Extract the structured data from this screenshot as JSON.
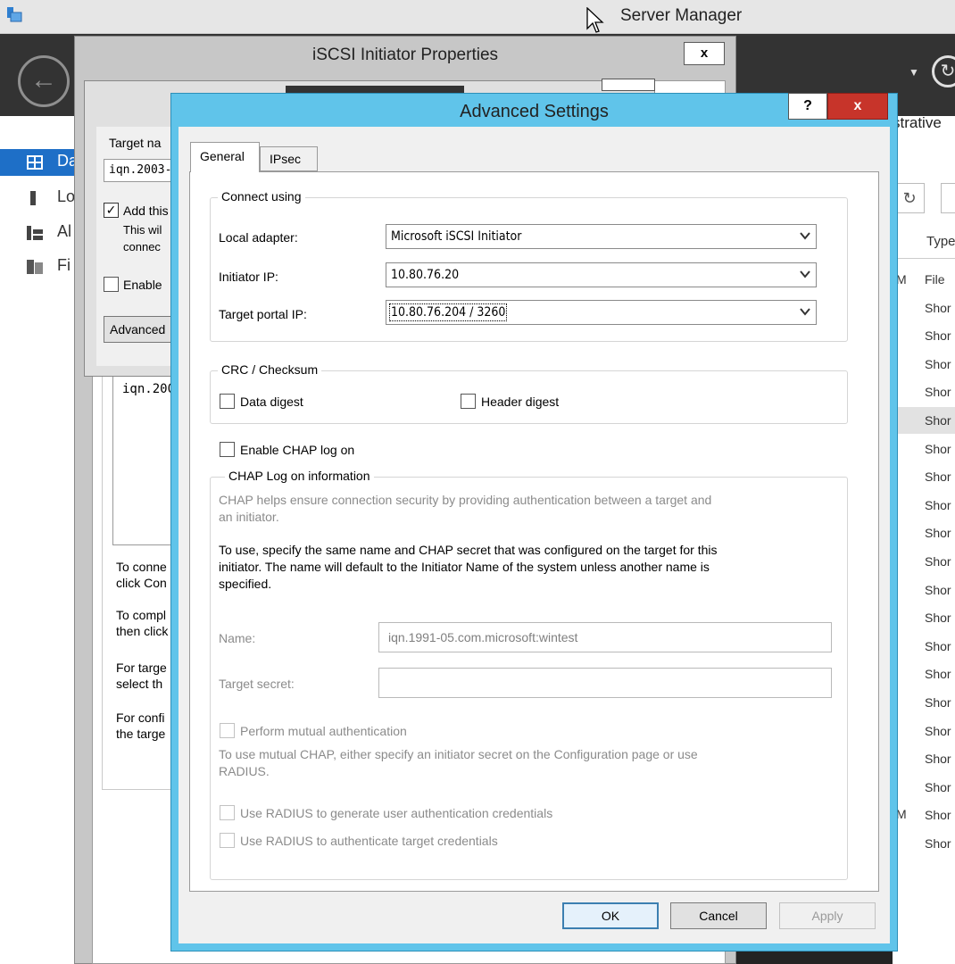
{
  "server_manager": {
    "title": "Server Manager",
    "nav": [
      {
        "label": "Da",
        "icon": "dashboard-icon"
      },
      {
        "label": "Lo",
        "icon": "local-server-icon"
      },
      {
        "label": "Al",
        "icon": "all-servers-icon"
      },
      {
        "label": "Fi",
        "icon": "file-services-icon"
      }
    ],
    "admin_label": "strative",
    "column_type": "Type",
    "rows": [
      "File",
      "Shor",
      "Shor",
      "Shor",
      "Shor",
      "Shor",
      "Shor",
      "Shor",
      "Shor",
      "Shor",
      "Shor",
      "Shor",
      "Shor",
      "Shor",
      "Shor",
      "Shor",
      "Shor",
      "Shor",
      "Shor",
      "Shor",
      "Shor"
    ],
    "row_left_marks": [
      "M",
      "M"
    ]
  },
  "iscsi_window": {
    "title": "iSCSI Initiator Properties",
    "close_label": "x",
    "list_item": "iqn.200",
    "texts": [
      [
        "To conne",
        "click Con"
      ],
      [
        "To compl",
        "then click"
      ],
      [
        "For targe",
        "select th"
      ],
      [
        "For confi",
        "the targe"
      ]
    ]
  },
  "connect_window": {
    "target_label": "Target na",
    "target_value": "iqn.2003-",
    "add_checked_mark": "✓",
    "add_label": "Add this",
    "desc1": "This wil",
    "desc2": "connec",
    "enable_label": "Enable",
    "advanced_label": "Advanced"
  },
  "advanced": {
    "title": "Advanced Settings",
    "help_label": "?",
    "close_label": "x",
    "tabs": [
      {
        "label": "General",
        "active": true
      },
      {
        "label": "IPsec",
        "active": false
      }
    ],
    "connect_using": {
      "title": "Connect using",
      "local_adapter_label": "Local adapter:",
      "local_adapter_value": "Microsoft iSCSI Initiator",
      "initiator_ip_label": "Initiator IP:",
      "initiator_ip_value": "10.80.76.20",
      "target_portal_label": "Target portal IP:",
      "target_portal_value": "10.80.76.204 / 3260"
    },
    "crc": {
      "title": "CRC / Checksum",
      "data_digest": "Data digest",
      "header_digest": "Header digest"
    },
    "enable_chap": "Enable CHAP log on",
    "chap": {
      "title": "CHAP Log on information",
      "help_text_1": "CHAP helps ensure connection security by providing authentication between a target and",
      "help_text_2": "an initiator.",
      "instr_1": "To use, specify the same name and CHAP secret that was configured on the target for this",
      "instr_2": "initiator.  The name will default to the Initiator Name of the system unless another name is",
      "instr_3": "specified.",
      "name_label": "Name:",
      "name_value": "iqn.1991-05.com.microsoft:wintest",
      "secret_label": "Target secret:",
      "secret_value": "",
      "mutual_label": "Perform mutual authentication",
      "mutual_text_1": "To use mutual CHAP, either specify an initiator secret on the Configuration page or use",
      "mutual_text_2": "RADIUS.",
      "radius_user": "Use RADIUS to generate user authentication credentials",
      "radius_target": "Use RADIUS to authenticate target credentials"
    },
    "buttons": {
      "ok": "OK",
      "cancel": "Cancel",
      "apply": "Apply"
    }
  }
}
